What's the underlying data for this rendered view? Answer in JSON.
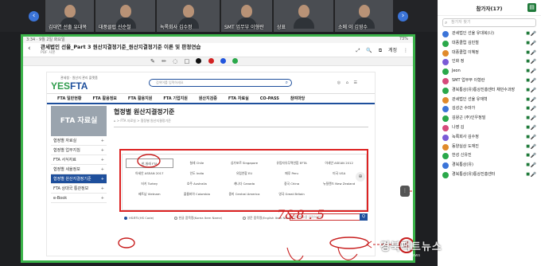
{
  "gallery": {
    "tiles": [
      {
        "name": "김대연 선출 유대복"
      },
      {
        "name": "대풍클럽 신순철"
      },
      {
        "name": "녹록회사 김수정"
      },
      {
        "name": "SMT 업무부 이형란"
      },
      {
        "name": "상표 "
      },
      {
        "name": "소메 이 김영수"
      }
    ]
  },
  "screen": {
    "status_left": "3:34 · 9월 2일 화요일",
    "status_right": "73%",
    "pdf_title": "관세법인 선율_Part 3 원산지결정기준_원산지결정기준 이론 및 판정연습",
    "pdf_sub": "PDF 사본",
    "tools": [
      "⤢",
      "🔍",
      "⧉",
      "계정",
      "⋮"
    ],
    "draw_tools": [
      "✎",
      "✏",
      "◌",
      "□"
    ],
    "pen_colors": [
      "#111111",
      "#d22222",
      "#2255dd",
      "#2aa84a"
    ],
    "site": {
      "logo_gov": "관세청 · 원산지 관리 플랫폼",
      "logo_mark_a": "YES",
      "logo_mark_b": "FTA",
      "search_placeholder": "검색어를 입력하세요",
      "icons": [
        "◎",
        "⌂",
        "☰"
      ],
      "gnb": [
        "FTA 일반현황",
        "FTA 활용정보",
        "FTA 활용지원",
        "FTA 기업지원",
        "원산지검증",
        "FTA 자료실",
        "CO-PASS",
        "참여마당"
      ],
      "side_hero": "FTA 자료실",
      "side_items": [
        {
          "label": "협정별 자료실",
          "active": false
        },
        {
          "label": "협정별 업무지침",
          "active": false
        },
        {
          "label": "FTA 서식자료",
          "active": false
        },
        {
          "label": "협정별 세율정보",
          "active": false
        },
        {
          "label": "협정별 원산지결정기준",
          "active": true
        },
        {
          "label": "FTA 상대국 통관정보",
          "active": false
        },
        {
          "label": "e-Book",
          "active": false
        }
      ],
      "content_title": "협정별 원산지결정기준",
      "breadcrumb": "⌂ > FTA 자료실 > 협정별 원산지결정기준",
      "agreements": [
        "한-칠레 FTA",
        "칠레 Chile",
        "싱가포르 Singapore",
        "유럽자유무역연합 EFTA",
        "아세안 ASEAN 2012",
        "아세안 ASEAN 2017",
        "인도 India",
        "유럽연합 EU",
        "페루 Peru",
        "미국 USA",
        "터키 Turkey",
        "호주 Australia",
        "캐나다 Canada",
        "중국 China",
        "뉴질랜드 New Zealand",
        "베트남 Vietnam",
        "콜롬비아 Colombia",
        "중미 Central America",
        "영국 Great Britain",
        ""
      ],
      "options": [
        "HS코드(HS Code)",
        "한글 품목명(Korea Item Name)",
        "영문 품목명(English Item Name)"
      ],
      "hs_placeholder": "품목번호를 입력하세요",
      "go_label": "Q"
    },
    "annotation_circle": "4",
    "annotation_hand": "7&8 . 5"
  },
  "panel": {
    "title": "참가자(17)",
    "search_placeholder": "참가자 찾기",
    "participants": [
      {
        "name": "관세법인 선율 유대복(나)",
        "avatar": "#3b74d8"
      },
      {
        "name": "대풍클럽 김민철",
        "avatar": "#2aa84a"
      },
      {
        "name": "대풍클럽 이혜정",
        "avatar": "#e08a2b"
      },
      {
        "name": "인화 정",
        "avatar": "#7a5bd6"
      },
      {
        "name": "Jeon",
        "avatar": "#2aa84a"
      },
      {
        "name": "SMT 업무부 이형란",
        "avatar": "#d64a7b"
      },
      {
        "name": "경북통상(유)통상진흥센터 채민수과장",
        "avatar": "#2aa84a"
      },
      {
        "name": "관세법인 선율 유재혁",
        "avatar": "#e08a2b"
      },
      {
        "name": "김성근 수마가",
        "avatar": "#3b74d8"
      },
      {
        "name": "김왕근 (주)인우정밀",
        "avatar": "#2aa84a"
      },
      {
        "name": "나영 김",
        "avatar": "#d64a7b"
      },
      {
        "name": "녹록회사 김수정",
        "avatar": "#7a5bd6"
      },
      {
        "name": "동양실상 도재진",
        "avatar": "#e08a2b"
      },
      {
        "name": "한성 신유진",
        "avatar": "#2aa84a"
      },
      {
        "name": "경북통상(유)",
        "avatar": "#3b74d8"
      },
      {
        "name": "경북통상(유)통상진흥센터",
        "avatar": "#2aa84a"
      }
    ]
  },
  "watermark": {
    "small": "경북팩트 news",
    "main": "경북팩트뉴스",
    "url": "kyongbuk.fact.news"
  }
}
